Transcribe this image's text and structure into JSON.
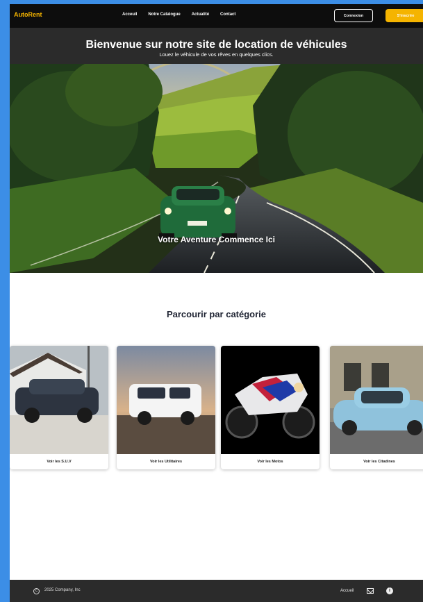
{
  "nav": {
    "brand": "AutoRent",
    "links": [
      "Acceuil",
      "Notre Catalogue",
      "Actualité",
      "Contact"
    ],
    "login_label": "Connexion",
    "signup_label": "S'inscrire"
  },
  "hero": {
    "title": "Bienvenue sur notre site de location de véhicules",
    "subtitle": "Louez le véhicule de vos rêves en quelques clics.",
    "caption": "Votre Aventure Commence Ici"
  },
  "categories": {
    "title": "Parcourir par catégorie",
    "items": [
      {
        "label": "Voir les S.U.V"
      },
      {
        "label": "Voir les Utilitaires"
      },
      {
        "label": "Voir les Motos"
      },
      {
        "label": "Voir les Citadines"
      }
    ]
  },
  "footer": {
    "copyright": "2025 Company, Inc",
    "link_home": "Accueil",
    "icons": [
      "mail-icon",
      "info-icon"
    ]
  },
  "colors": {
    "accent": "#f5b400",
    "nav_bg": "#0d0d0d",
    "band_bg": "#2b2b2b",
    "page_bg": "#3c8ee6"
  }
}
